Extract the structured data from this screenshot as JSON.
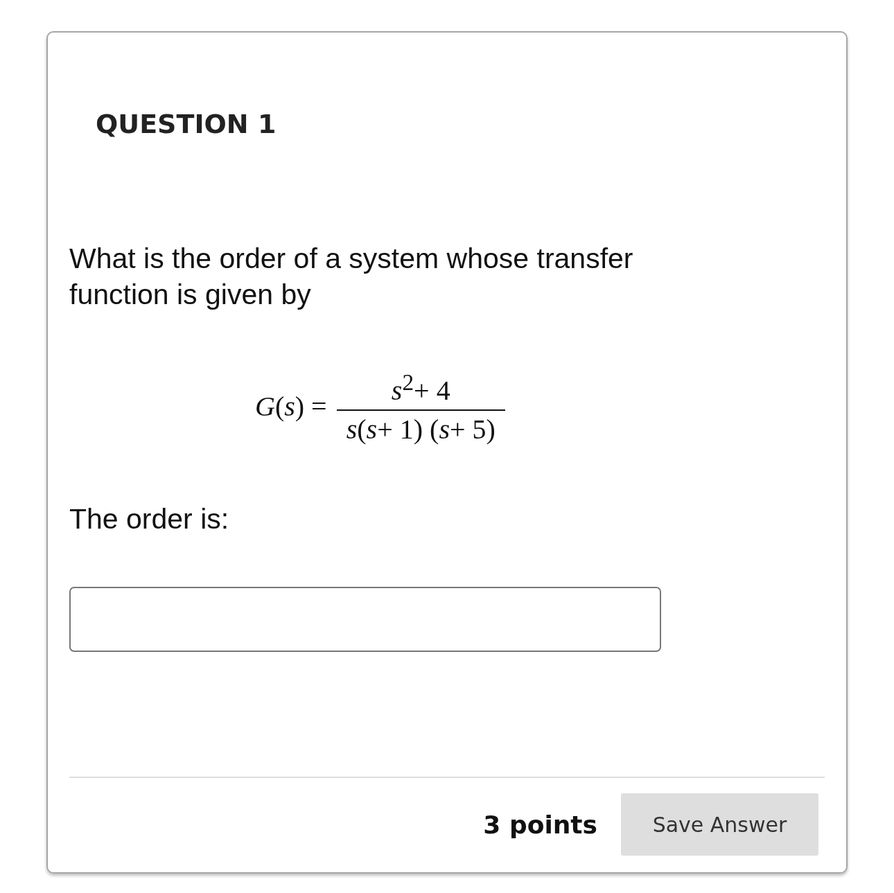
{
  "question": {
    "title": "QUESTION 1",
    "prompt": "What is the order of a system whose transfer function is given by",
    "formula": {
      "lhs": "*G*(*s*) =",
      "numerator": "*s*$^{2}$+ 4",
      "denominator": "*s*(*s*+ 1) (*s*+ 5)"
    },
    "answer_label": "The order is:",
    "points": "3 points",
    "save_button": "Save Answer"
  }
}
